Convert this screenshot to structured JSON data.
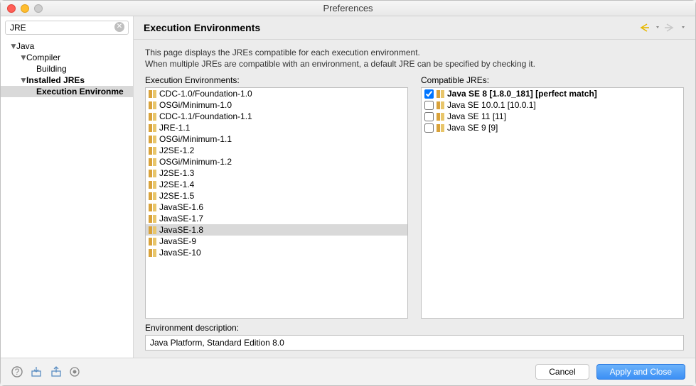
{
  "window": {
    "title": "Preferences"
  },
  "search": {
    "value": "JRE"
  },
  "tree": {
    "items": [
      {
        "label": "Java",
        "indent": 1,
        "twist": "▼",
        "bold": false
      },
      {
        "label": "Compiler",
        "indent": 2,
        "twist": "▼",
        "bold": false
      },
      {
        "label": "Building",
        "indent": 3,
        "twist": "",
        "bold": false
      },
      {
        "label": "Installed JREs",
        "indent": 2,
        "twist": "▼",
        "bold": true
      },
      {
        "label": "Execution Environme",
        "indent": 3,
        "twist": "",
        "bold": true,
        "selected": true
      }
    ]
  },
  "page": {
    "title": "Execution Environments",
    "description": "This page displays the JREs compatible for each execution environment.\nWhen multiple JREs are compatible with an environment, a default JRE can be specified by checking it.",
    "environments_label": "Execution Environments:",
    "environments": [
      "CDC-1.0/Foundation-1.0",
      "OSGi/Minimum-1.0",
      "CDC-1.1/Foundation-1.1",
      "JRE-1.1",
      "OSGi/Minimum-1.1",
      "J2SE-1.2",
      "OSGi/Minimum-1.2",
      "J2SE-1.3",
      "J2SE-1.4",
      "J2SE-1.5",
      "JavaSE-1.6",
      "JavaSE-1.7",
      "JavaSE-1.8",
      "JavaSE-9",
      "JavaSE-10"
    ],
    "selected_env_index": 12,
    "compatible_label": "Compatible JREs:",
    "compatible_jres": [
      {
        "label": "Java SE 8 [1.8.0_181] [perfect match]",
        "checked": true,
        "bold": true
      },
      {
        "label": "Java SE 10.0.1 [10.0.1]",
        "checked": false,
        "bold": false
      },
      {
        "label": "Java SE 11 [11]",
        "checked": false,
        "bold": false
      },
      {
        "label": "Java SE 9 [9]",
        "checked": false,
        "bold": false
      }
    ],
    "env_desc_label": "Environment description:",
    "env_desc_value": "Java Platform, Standard Edition 8.0"
  },
  "footer": {
    "cancel": "Cancel",
    "apply": "Apply and Close"
  }
}
